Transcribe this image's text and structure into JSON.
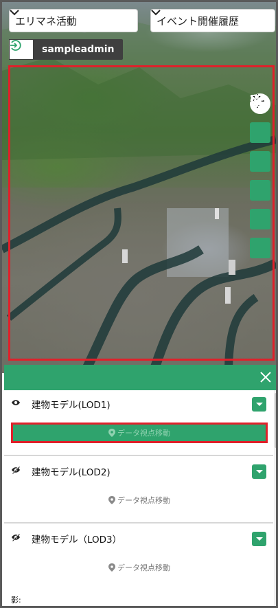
{
  "header": {
    "category_select": "エリマネ活動",
    "event_select": "イベント開催履歴"
  },
  "user": {
    "name": "sampleadmin",
    "login_icon": "login-icon"
  },
  "map_tools": [
    {
      "name": "locate-icon"
    },
    {
      "name": "filter-sliders-icon"
    },
    {
      "name": "list-icon"
    },
    {
      "name": "search-icon"
    },
    {
      "name": "network-icon"
    },
    {
      "name": "people-icon"
    }
  ],
  "layers": [
    {
      "label": "建物モデル(LOD1)",
      "visible": true,
      "move_label": "データ視点移動",
      "move_active": true
    },
    {
      "label": "建物モデル(LOD2)",
      "visible": false,
      "move_label": "データ視点移動",
      "move_active": false
    },
    {
      "label": "建物モデル（LOD3）",
      "visible": false,
      "move_label": "データ視点移動",
      "move_active": false
    }
  ],
  "shadow_label": "影:",
  "colors": {
    "accent": "#2fa36d",
    "highlight": "#e0202a"
  }
}
